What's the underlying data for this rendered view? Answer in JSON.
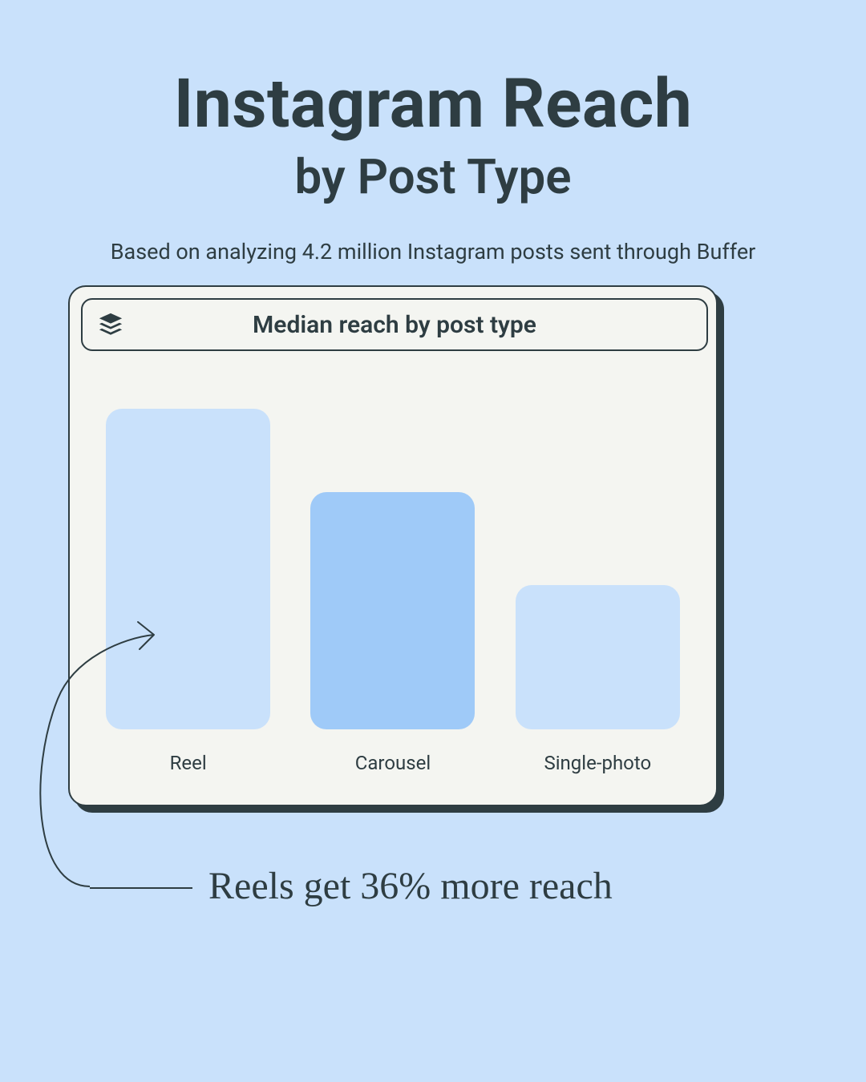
{
  "title_line1": "Instagram Reach",
  "title_line2": "by Post Type",
  "subtitle": "Based on analyzing 4.2 million Instagram posts sent through Buffer",
  "card_title": "Median reach by post type",
  "icon_name": "buffer-logo-icon",
  "annotation": "Reels get 36% more reach",
  "colors": {
    "bg": "#c9e1fb",
    "card": "#f4f5f1",
    "stroke": "#2e3d42",
    "bar_light": "#c9e1fb",
    "bar_mid": "#9fcaf8"
  },
  "chart_data": {
    "type": "bar",
    "title": "Median reach by post type",
    "xlabel": "",
    "ylabel": "",
    "ylim": [
      0,
      100
    ],
    "categories": [
      "Reel",
      "Carousel",
      "Single-photo"
    ],
    "values": [
      100,
      74,
      45
    ],
    "bar_colors": [
      "#c9e1fb",
      "#9fcaf8",
      "#c9e1fb"
    ]
  }
}
